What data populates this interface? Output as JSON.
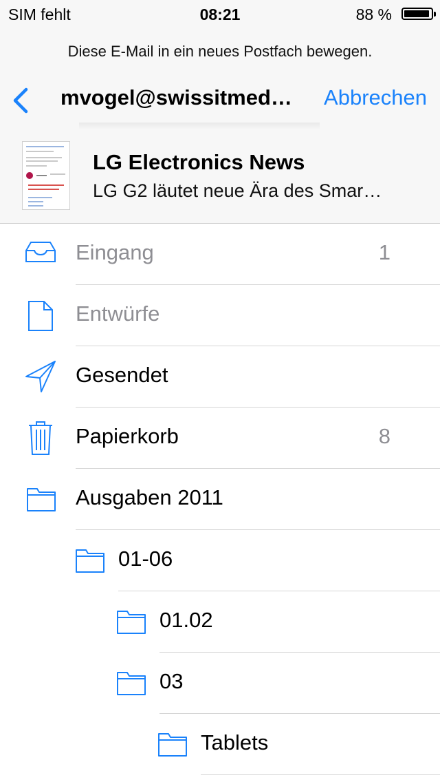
{
  "status_bar": {
    "carrier": "SIM fehlt",
    "time": "08:21",
    "battery": "88 %"
  },
  "prompt": "Diese E-Mail in ein neues Postfach bewegen.",
  "nav": {
    "title": "mvogel@swissitmed…",
    "cancel": "Abbrechen"
  },
  "message": {
    "sender": "LG Electronics News",
    "subject": "LG G2 läutet neue Ära des Smar…"
  },
  "accent": "#1a82fb",
  "mailboxes": [
    {
      "label": "Eingang",
      "count": "1",
      "icon": "inbox-icon"
    },
    {
      "label": "Entwürfe",
      "count": "",
      "icon": "draft-icon"
    },
    {
      "label": "Gesendet",
      "count": "",
      "icon": "sent-icon"
    },
    {
      "label": "Papierkorb",
      "count": "8",
      "icon": "trash-icon"
    },
    {
      "label": "Ausgaben 2011",
      "count": "",
      "icon": "folder-icon"
    },
    {
      "label": "01-06",
      "count": "",
      "icon": "folder-icon"
    },
    {
      "label": "01.02",
      "count": "",
      "icon": "folder-icon"
    },
    {
      "label": "03",
      "count": "",
      "icon": "folder-icon"
    },
    {
      "label": "Tablets",
      "count": "",
      "icon": "folder-icon"
    }
  ]
}
